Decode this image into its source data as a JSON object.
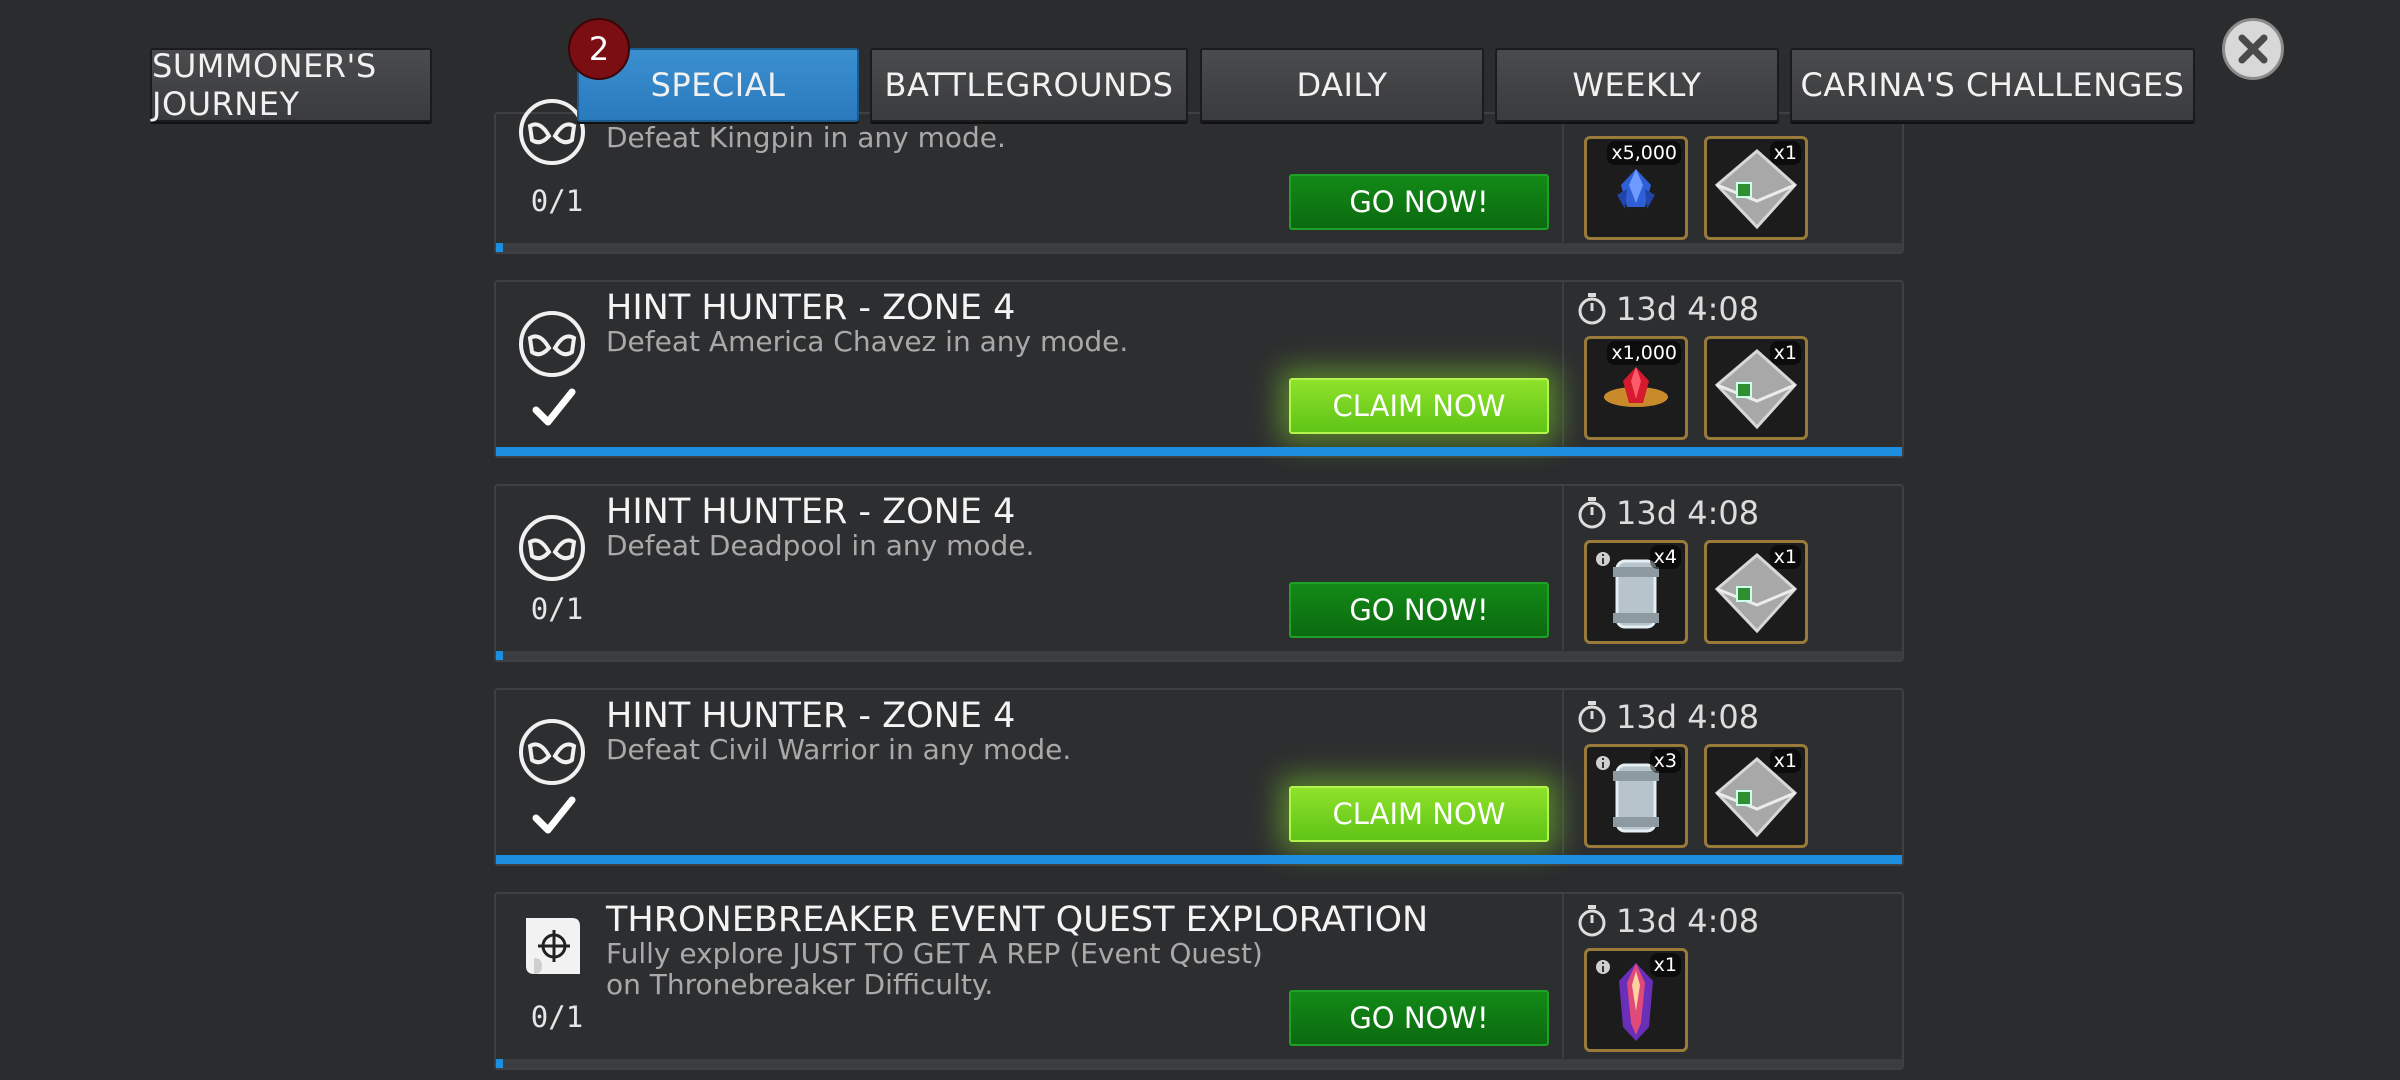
{
  "tabs": [
    {
      "label": "SUMMONER'S JOURNEY",
      "active": false
    },
    {
      "label": "SPECIAL",
      "active": true,
      "badge": "2"
    },
    {
      "label": "BATTLEGROUNDS",
      "active": false
    },
    {
      "label": "DAILY",
      "active": false
    },
    {
      "label": "WEEKLY",
      "active": false
    },
    {
      "label": "CARINA'S CHALLENGES",
      "active": false
    }
  ],
  "colors": {
    "background": "#2a2c2e",
    "tab_active": "#2f83c6",
    "progress": "#1e8fe0",
    "go_button": "#0f7a13",
    "claim_button": "#78d321",
    "badge": "#7a0e12"
  },
  "quests": [
    {
      "title": "",
      "description": "Defeat Kingpin in any mode.",
      "status": "0/1",
      "completed": false,
      "button": "GO NOW!",
      "timer": "",
      "progress": 0.005,
      "rewards": [
        {
          "icon": "blue-crystal-icon",
          "qty": "x5,000"
        },
        {
          "icon": "silver-envelope-icon",
          "qty": "x1"
        }
      ]
    },
    {
      "title": "HINT HUNTER - ZONE 4",
      "description": "Defeat America Chavez in any mode.",
      "status": "",
      "completed": true,
      "button": "CLAIM NOW",
      "timer": "13d 4:08",
      "progress": 1.0,
      "rewards": [
        {
          "icon": "red-gem-icon",
          "qty": "x1,000"
        },
        {
          "icon": "silver-envelope-icon",
          "qty": "x1"
        }
      ]
    },
    {
      "title": "HINT HUNTER - ZONE 4",
      "description": "Defeat Deadpool in any mode.",
      "status": "0/1",
      "completed": false,
      "button": "GO NOW!",
      "timer": "13d 4:08",
      "progress": 0.005,
      "rewards": [
        {
          "icon": "canister-icon",
          "qty": "x4"
        },
        {
          "icon": "silver-envelope-icon",
          "qty": "x1"
        }
      ]
    },
    {
      "title": "HINT HUNTER - ZONE 4",
      "description": "Defeat Civil Warrior in any mode.",
      "status": "",
      "completed": true,
      "button": "CLAIM NOW",
      "timer": "13d 4:08",
      "progress": 1.0,
      "rewards": [
        {
          "icon": "canister-icon",
          "qty": "x3"
        },
        {
          "icon": "silver-envelope-icon",
          "qty": "x1"
        }
      ]
    },
    {
      "title": "THRONEBREAKER EVENT QUEST EXPLORATION",
      "description": "Fully explore JUST TO GET A REP (Event Quest) on Thronebreaker Difficulty.",
      "status": "0/1",
      "completed": false,
      "button": "GO NOW!",
      "timer": "13d 4:08",
      "progress": 0.005,
      "rewards": [
        {
          "icon": "purple-crystal-icon",
          "qty": "x1"
        }
      ]
    }
  ]
}
